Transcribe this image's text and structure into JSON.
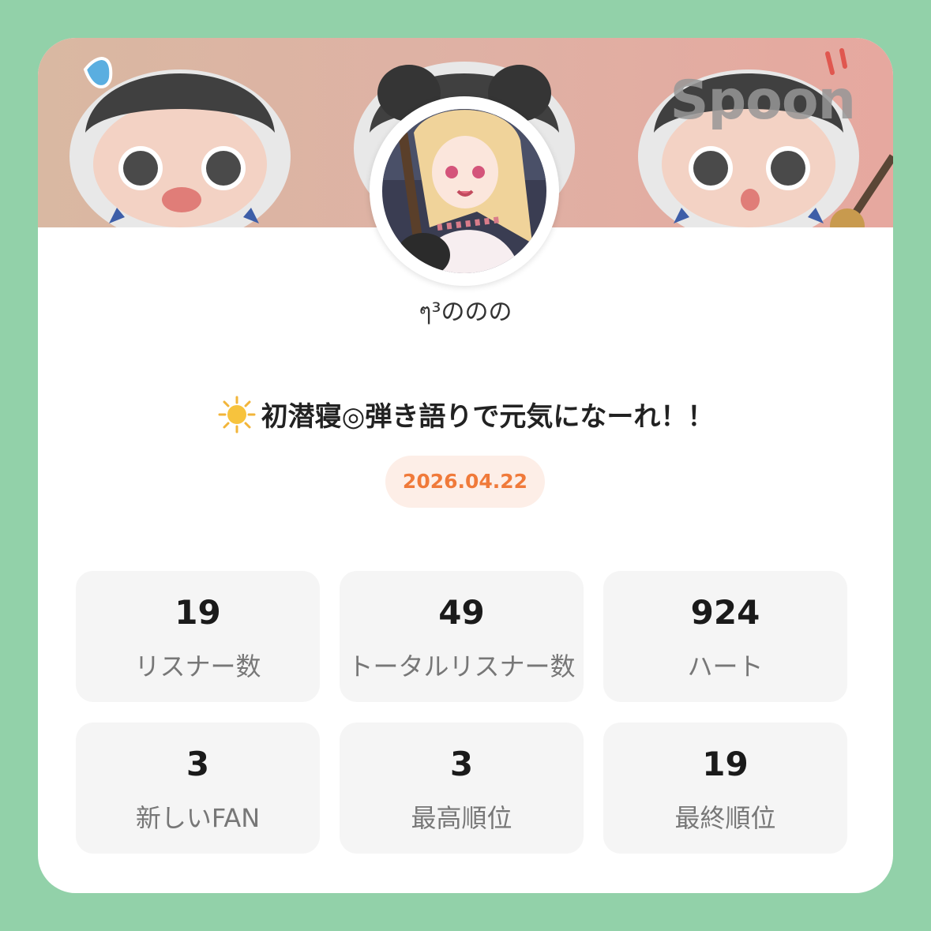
{
  "brand": "Spoon",
  "user": {
    "name": "ๆ³ののの"
  },
  "broadcast": {
    "title": "初潜寝◎弾き語りで元気になーれ！！",
    "title_icon": "sun-icon",
    "date": "2026.04.22"
  },
  "stats": [
    {
      "value": "19",
      "label": "リスナー数"
    },
    {
      "value": "49",
      "label": "トータルリスナー数"
    },
    {
      "value": "924",
      "label": "ハート"
    },
    {
      "value": "3",
      "label": "新しいFAN"
    },
    {
      "value": "3",
      "label": "最高順位"
    },
    {
      "value": "19",
      "label": "最終順位"
    }
  ],
  "colors": {
    "background": "#92d1a9",
    "card": "#ffffff",
    "date_text": "#f07a3a",
    "date_bg": "#fdeee7",
    "stat_bg": "#f5f5f5"
  }
}
